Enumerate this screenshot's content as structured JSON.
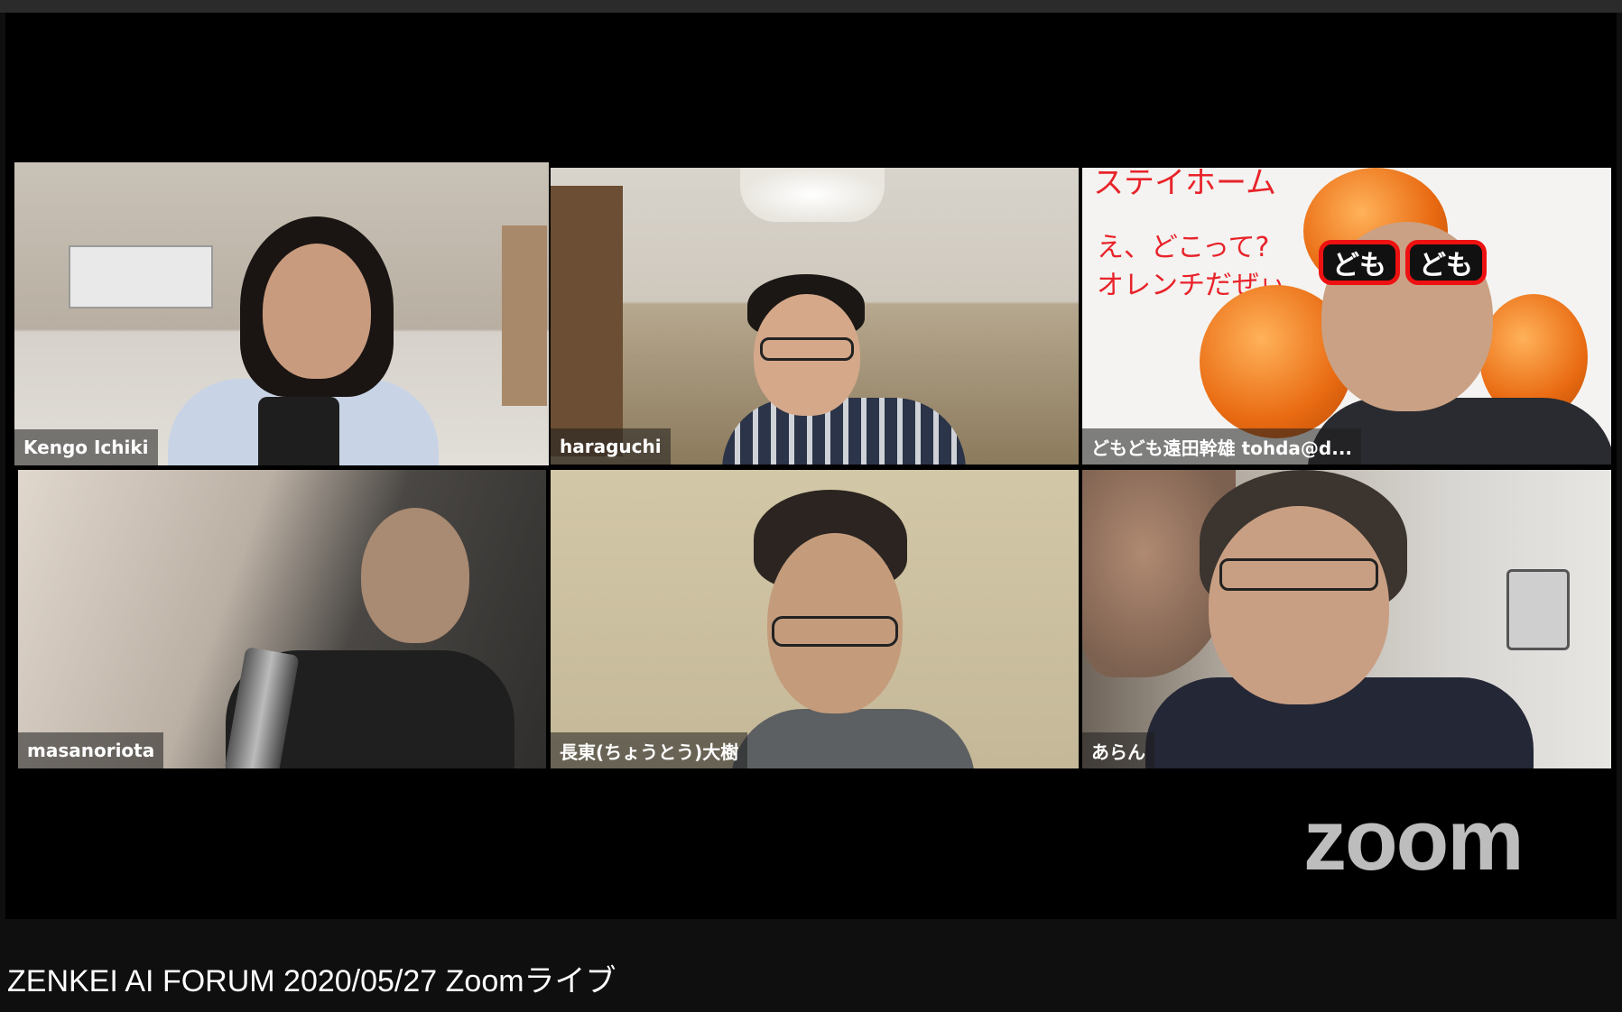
{
  "meeting": {
    "brand_logo": "zoom",
    "participants": [
      {
        "name": "Kengo Ichiki",
        "active_speaker": true
      },
      {
        "name": "haraguchi",
        "active_speaker": false
      },
      {
        "name": "どもども遠田幹雄 tohda@d...",
        "active_speaker": false
      },
      {
        "name": "masanoriota",
        "active_speaker": false
      },
      {
        "name": "長東(ちょうとう)大樹",
        "active_speaker": false
      },
      {
        "name": "あらん",
        "active_speaker": false
      }
    ],
    "virtual_background_text": {
      "line1": "ステイホーム",
      "line2": "え、どこって?",
      "line3": "オレンチだぜぃ",
      "glasses_left": "ども",
      "glasses_right": "ども"
    },
    "active_speaker_border_color": "#5ee22f"
  },
  "video": {
    "title": "ZENKEI AI FORUM 2020/05/27 Zoomライブ"
  }
}
